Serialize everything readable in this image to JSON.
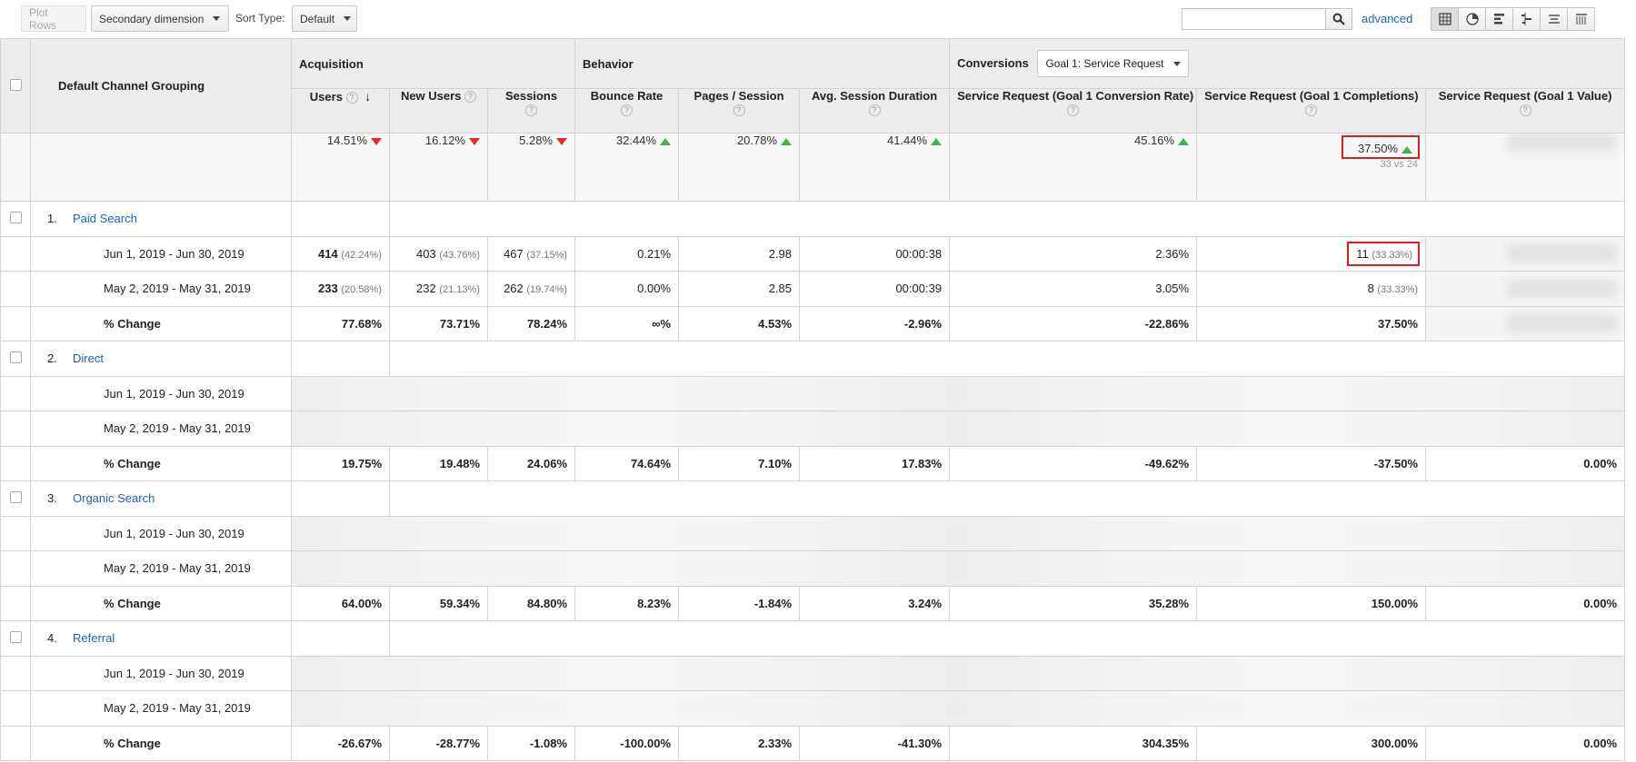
{
  "toolbar": {
    "plot_rows": "Plot Rows",
    "secondary_dimension": "Secondary dimension",
    "sort_type_label": "Sort Type:",
    "sort_type_value": "Default",
    "search_value": "",
    "advanced": "advanced"
  },
  "header": {
    "dimension": "Default Channel Grouping",
    "acquisition": "Acquisition",
    "behavior": "Behavior",
    "conversions": "Conversions",
    "goal_select": "Goal 1: Service Request",
    "columns": [
      "Users",
      "New Users",
      "Sessions",
      "Bounce Rate",
      "Pages / Session",
      "Avg. Session Duration",
      "Service Request (Goal 1 Conversion Rate)",
      "Service Request (Goal 1 Completions)",
      "Service Request (Goal 1 Value)"
    ]
  },
  "summary": {
    "values": [
      "14.51%",
      "16.12%",
      "5.28%",
      "32.44%",
      "20.78%",
      "41.44%",
      "45.16%",
      "37.50%"
    ],
    "directions": [
      "down",
      "down",
      "down",
      "up",
      "up",
      "up",
      "up",
      "up"
    ],
    "completions_sub": "33 vs 24"
  },
  "channels": [
    {
      "index": "1.",
      "name": "Paid Search",
      "rows": [
        {
          "label": "Jun 1, 2019 - Jun 30, 2019",
          "users": "414",
          "users_pct": "(42.24%)",
          "new_users": "403",
          "new_users_pct": "(43.76%)",
          "sessions": "467",
          "sessions_pct": "(37.15%)",
          "bounce": "0.21%",
          "pages": "2.98",
          "duration": "00:00:38",
          "conv_rate": "2.36%",
          "completions": "11",
          "completions_pct": "(33.33%)"
        },
        {
          "label": "May 2, 2019 - May 31, 2019",
          "users": "233",
          "users_pct": "(20.58%)",
          "new_users": "232",
          "new_users_pct": "(21.13%)",
          "sessions": "262",
          "sessions_pct": "(19.74%)",
          "bounce": "0.00%",
          "pages": "2.85",
          "duration": "00:00:39",
          "conv_rate": "3.05%",
          "completions": "8",
          "completions_pct": "(33.33%)"
        }
      ],
      "change": {
        "label": "% Change",
        "values": [
          "77.68%",
          "73.71%",
          "78.24%",
          "∞%",
          "4.53%",
          "-2.96%",
          "-22.86%",
          "37.50%",
          ""
        ]
      }
    },
    {
      "index": "2.",
      "name": "Direct",
      "rows": [
        {
          "label": "Jun 1, 2019 - Jun 30, 2019"
        },
        {
          "label": "May 2, 2019 - May 31, 2019"
        }
      ],
      "change": {
        "label": "% Change",
        "values": [
          "19.75%",
          "19.48%",
          "24.06%",
          "74.64%",
          "7.10%",
          "17.83%",
          "-49.62%",
          "-37.50%",
          "0.00%"
        ]
      }
    },
    {
      "index": "3.",
      "name": "Organic Search",
      "rows": [
        {
          "label": "Jun 1, 2019 - Jun 30, 2019"
        },
        {
          "label": "May 2, 2019 - May 31, 2019"
        }
      ],
      "change": {
        "label": "% Change",
        "values": [
          "64.00%",
          "59.34%",
          "84.80%",
          "8.23%",
          "-1.84%",
          "3.24%",
          "35.28%",
          "150.00%",
          "0.00%"
        ]
      }
    },
    {
      "index": "4.",
      "name": "Referral",
      "rows": [
        {
          "label": "Jun 1, 2019 - Jun 30, 2019"
        },
        {
          "label": "May 2, 2019 - May 31, 2019"
        }
      ],
      "change": {
        "label": "% Change",
        "values": [
          "-26.67%",
          "-28.77%",
          "-1.08%",
          "-100.00%",
          "2.33%",
          "-41.30%",
          "304.35%",
          "300.00%",
          "0.00%"
        ]
      }
    }
  ],
  "colors": {
    "accent_link": "#1a64b4",
    "up_arrow": "#3eb54a",
    "down_arrow": "#e52b2b",
    "highlight_box": "#d42020"
  },
  "icons": [
    "search-icon",
    "grid-view-icon",
    "pie-view-icon",
    "bar-view-icon",
    "comparison-view-icon",
    "term-cloud-icon",
    "pivot-view-icon",
    "sort-down-arrow-icon",
    "help-icon"
  ]
}
